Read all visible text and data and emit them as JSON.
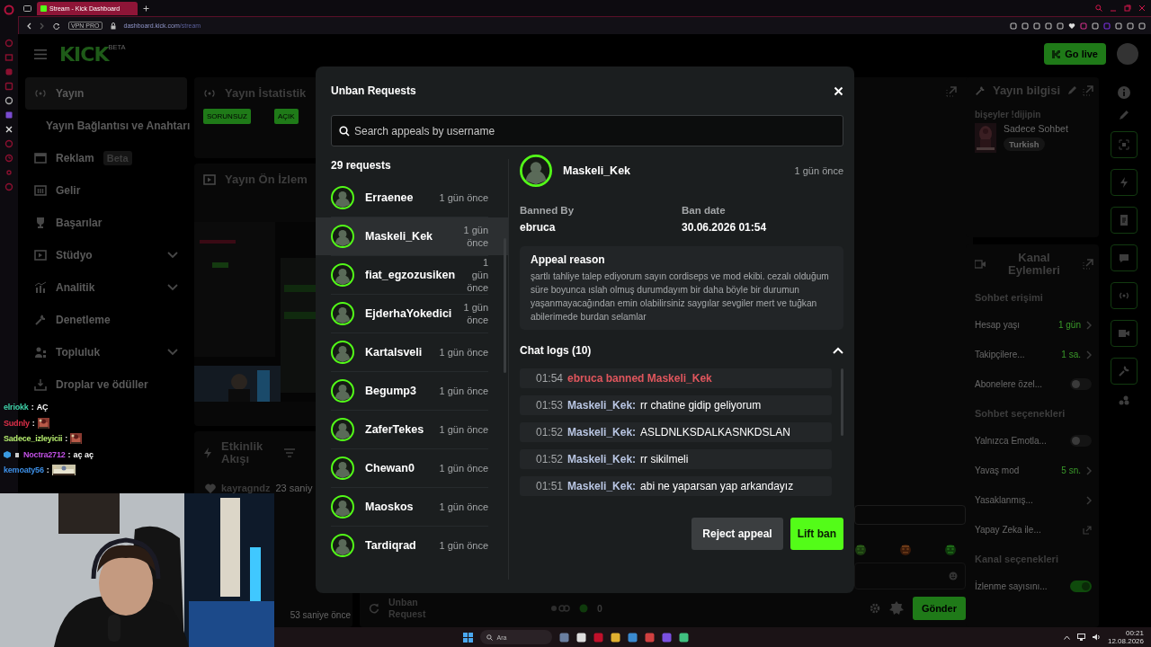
{
  "browser": {
    "tab_title": "Stream - Kick Dashboard",
    "vpn_badge": "VPN PRO",
    "url_host": "dashboard.kick.com",
    "url_path": "/stream"
  },
  "dashboard": {
    "logo": "KICK",
    "logo_badge": "BETA",
    "go_live": "Go live",
    "nav": [
      {
        "kind": "item",
        "label": "Yayın",
        "selected": true,
        "expandable": false
      },
      {
        "kind": "subitem",
        "label": "Yayın Bağlantısı ve Anahtarı",
        "selected": false,
        "expandable": false
      },
      {
        "kind": "item",
        "label": "Reklam",
        "badge": "Beta",
        "selected": false,
        "expandable": false
      },
      {
        "kind": "item",
        "label": "Gelir",
        "selected": false,
        "expandable": false
      },
      {
        "kind": "item",
        "label": "Başarılar",
        "selected": false,
        "expandable": false
      },
      {
        "kind": "item",
        "label": "Stüdyo",
        "selected": false,
        "expandable": true
      },
      {
        "kind": "item",
        "label": "Analitik",
        "selected": false,
        "expandable": true
      },
      {
        "kind": "item",
        "label": "Denetleme",
        "selected": false,
        "expandable": false
      },
      {
        "kind": "item",
        "label": "Topluluk",
        "selected": false,
        "expandable": true
      },
      {
        "kind": "item",
        "label": "Droplar ve ödüller",
        "selected": false,
        "expandable": false
      }
    ],
    "stats_panel": {
      "title": "Yayın İstatistik",
      "badges": [
        "SORUNSUZ",
        "AÇIK"
      ]
    },
    "preview_panel": {
      "title": "Yayın Ön İzlem",
      "kind": "picture"
    },
    "activity_panel": {
      "title": "Etkinlik Akışı",
      "events": [
        {
          "user": "kayragndz",
          "time": "23 saniy"
        }
      ],
      "footer": "53 saniye önce"
    },
    "chat_panel": {
      "unban_tab": "Unban Request",
      "count": "0",
      "send": "Gönder"
    },
    "stream_info": {
      "title": "Yayın bilgisi",
      "stream_title": "bişeyler !dijipin",
      "category": "Sadece Sohbet",
      "tag": "Turkish"
    },
    "channel_actions": {
      "title": "Kanal Eylemleri",
      "sections": [
        {
          "title": "Sohbet erişimi",
          "rows": [
            {
              "kind": "value",
              "label": "Hesap yaşı",
              "value": "1 gün"
            },
            {
              "kind": "value",
              "label": "Takipçilere...",
              "value": "1 sa."
            },
            {
              "kind": "toggle",
              "label": "Abonelere özel...",
              "on": false
            }
          ]
        },
        {
          "title": "Sohbet seçenekleri",
          "rows": [
            {
              "kind": "toggle",
              "label": "Yalnızca Emotla...",
              "on": false
            },
            {
              "kind": "value",
              "label": "Yavaş mod",
              "value": "5 sn."
            },
            {
              "kind": "nav",
              "label": "Yasaklanmış..."
            },
            {
              "kind": "link",
              "label": "Yapay Zeka ile..."
            }
          ]
        },
        {
          "title": "Kanal seçenekleri",
          "rows": [
            {
              "kind": "toggle",
              "label": "İzlenme sayısını...",
              "on": true
            }
          ]
        }
      ]
    }
  },
  "unban_modal": {
    "title": "Unban Requests",
    "search_placeholder": "Search appeals by username",
    "count_label": "29 requests",
    "requests": [
      {
        "user": "Erraenee",
        "time": "1 gün önce",
        "selected": false
      },
      {
        "user": "Maskeli_Kek",
        "time": "1 gün önce",
        "selected": true
      },
      {
        "user": "fiat_egzozusiken",
        "time": "1 gün önce",
        "selected": false
      },
      {
        "user": "EjderhaYokedici",
        "time": "1 gün önce",
        "selected": false
      },
      {
        "user": "Kartalsveli",
        "time": "1 gün önce",
        "selected": false
      },
      {
        "user": "Begump3",
        "time": "1 gün önce",
        "selected": false
      },
      {
        "user": "ZaferTekes",
        "time": "1 gün önce",
        "selected": false
      },
      {
        "user": "Chewan0",
        "time": "1 gün önce",
        "selected": false
      },
      {
        "user": "Maoskos",
        "time": "1 gün önce",
        "selected": false
      },
      {
        "user": "Tardiqrad",
        "time": "1 gün önce",
        "selected": false
      }
    ],
    "detail": {
      "user": "Maskeli_Kek",
      "time": "1 gün önce",
      "banned_by_label": "Banned By",
      "banned_by": "ebruca",
      "ban_date_label": "Ban date",
      "ban_date": "30.06.2026 01:54",
      "appeal_title": "Appeal reason",
      "appeal_text": "şartlı tahliye talep ediyorum sayın cordiseps ve mod ekibi. cezalı olduğum süre boyunca ıslah olmuş durumdayım bir daha böyle bir durumun yaşanmayacağından emin olabilirsiniz saygılar sevgiler mert ve tuğkan abilerimede burdan selamlar",
      "chat_logs_title": "Chat logs (10)",
      "chat_logs_expanded": true,
      "chat_logs": [
        {
          "kind": "ban",
          "time": "01:54",
          "text": "ebruca banned Maskeli_Kek"
        },
        {
          "kind": "message",
          "time": "01:53",
          "user": "Maskeli_Kek:",
          "text": "rr chatine gidip geliyorum"
        },
        {
          "kind": "message",
          "time": "01:52",
          "user": "Maskeli_Kek:",
          "text": "ASLDNLKSDALKASNKDSLAN"
        },
        {
          "kind": "message",
          "time": "01:52",
          "user": "Maskeli_Kek:",
          "text": "rr sikilmeli"
        },
        {
          "kind": "message",
          "time": "01:51",
          "user": "Maskeli_Kek:",
          "text": "abi ne yaparsan yap arkandayız"
        }
      ]
    },
    "reject_button": "Reject appeal",
    "lift_button": "Lift ban"
  },
  "chat_overlay": [
    {
      "user": "elriokk",
      "color": "#3fd1a8",
      "separator": ":",
      "kind": "text",
      "text": "AÇ",
      "badges": false
    },
    {
      "user": "Sudnly",
      "color": "#e0304a",
      "separator": ":",
      "kind": "emote",
      "badges": false
    },
    {
      "user": "Sadece_izleyicii",
      "color": "#b5ec6e",
      "separator": ":",
      "kind": "emote",
      "badges": false
    },
    {
      "user": "Noctra2712",
      "color": "#c250e6",
      "separator": ":",
      "kind": "text",
      "text": "aç aç",
      "badges": true
    },
    {
      "user": "kemoaty56",
      "color": "#3d8fe6",
      "separator": ":",
      "kind": "emote",
      "badges": false
    }
  ],
  "taskbar": {
    "search": "Ara",
    "time": "00:21",
    "date": "12.08.2026"
  }
}
